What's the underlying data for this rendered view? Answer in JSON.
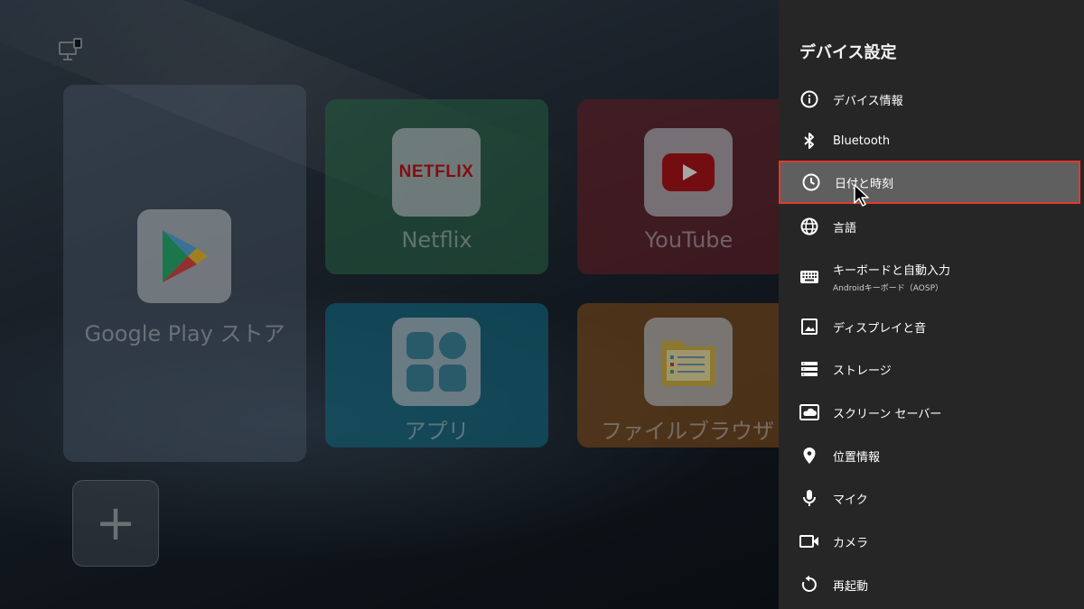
{
  "launcher": {
    "apps": [
      {
        "label": "Google Play ストア"
      },
      {
        "label": "Netflix",
        "logo_text": "NETFLIX"
      },
      {
        "label": "YouTube"
      },
      {
        "label": "アプリ"
      },
      {
        "label": "ファイルブラウザ"
      }
    ],
    "add_symbol": "+"
  },
  "settings_panel": {
    "title": "デバイス設定",
    "items": [
      {
        "label": "デバイス情報",
        "icon": "info-icon"
      },
      {
        "label": "Bluetooth",
        "icon": "bluetooth-icon"
      },
      {
        "label": "日付と時刻",
        "icon": "clock-icon",
        "selected": true
      },
      {
        "label": "言語",
        "icon": "globe-icon"
      },
      {
        "label": "キーボードと自動入力",
        "sublabel": "Androidキーボード（AOSP）",
        "icon": "keyboard-icon"
      },
      {
        "label": "ディスプレイと音",
        "icon": "display-image-icon"
      },
      {
        "label": "ストレージ",
        "icon": "storage-icon"
      },
      {
        "label": "スクリーン セーバー",
        "icon": "screensaver-icon"
      },
      {
        "label": "位置情報",
        "icon": "location-pin-icon"
      },
      {
        "label": "マイク",
        "icon": "microphone-icon"
      },
      {
        "label": "カメラ",
        "icon": "camera-icon"
      },
      {
        "label": "再起動",
        "icon": "restart-icon"
      }
    ]
  },
  "colors": {
    "panel_bg": "#262626",
    "selected_bg": "#5f5f5f",
    "selected_border": "#e03a2e"
  }
}
